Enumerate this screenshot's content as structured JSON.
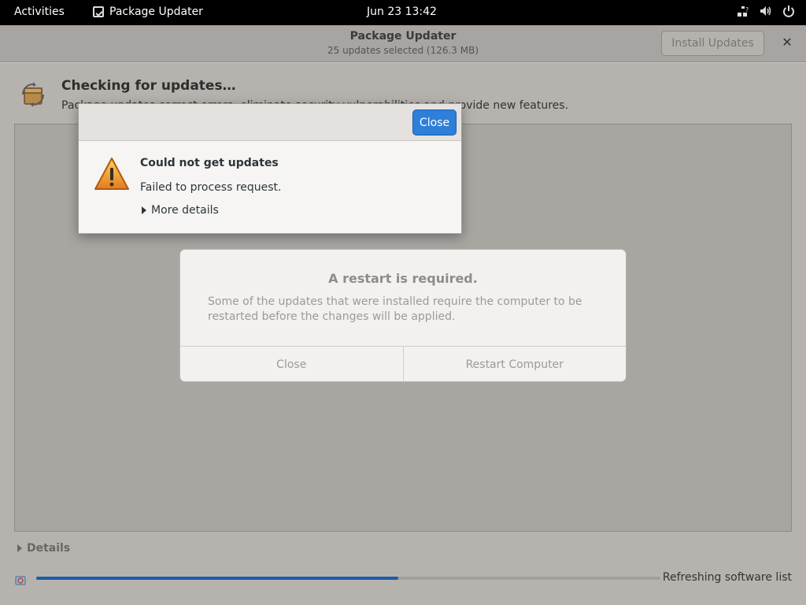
{
  "topbar": {
    "activities": "Activities",
    "app_name": "Package Updater",
    "clock": "Jun 23  13:42",
    "icons": [
      "network-wired-unknown-icon",
      "volume-icon",
      "power-icon"
    ]
  },
  "window": {
    "title": "Package Updater",
    "subtitle": "25 updates selected (126.3 MB)",
    "install_label": "Install Updates",
    "close_symbol": "✕"
  },
  "main": {
    "heading": "Checking for updates…",
    "description": "Package updates correct errors, eliminate security vulnerabilities and provide new features.",
    "details_label": "Details",
    "progress_fraction": 0.58,
    "progress_text": "Refreshing software list"
  },
  "restart_dialog": {
    "title": "A restart is required.",
    "body": "Some of the updates that were installed require the computer to be restarted before the changes will be applied.",
    "close_label": "Close",
    "restart_label": "Restart Computer"
  },
  "error_dialog": {
    "close_label": "Close",
    "title": "Could not get updates",
    "message": "Failed to process request.",
    "more_details": "More details"
  },
  "colors": {
    "accent": "#2d7fd9",
    "progress": "#1d5ba8",
    "warning": "#f0a030"
  }
}
